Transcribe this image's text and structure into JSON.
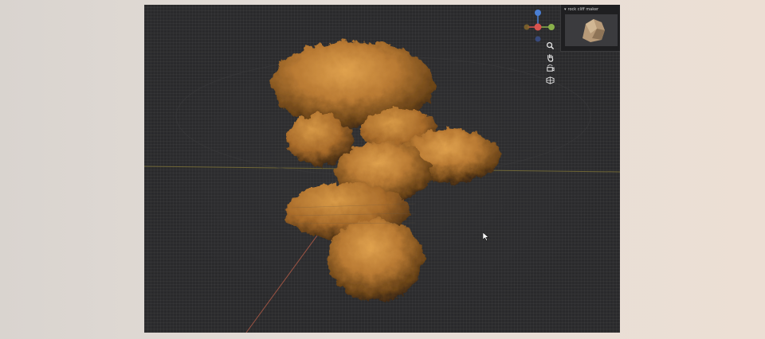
{
  "viewport": {
    "background": "#2a2a2c",
    "object_color": "#c98a3c",
    "x_axis_color": "#8a7a3a",
    "y_axis_color": "#c0604a"
  },
  "gizmo": {
    "x_axis_color": "#d9534f",
    "y_axis_color": "#8ab04a",
    "z_axis_color": "#4a7fd4"
  },
  "nav_icons": [
    "zoom-icon",
    "hand-pan-icon",
    "camera-orbit-icon",
    "grid-view-icon"
  ],
  "preview": {
    "title": "rock cliff maker",
    "thumb_color": "#b79a78"
  }
}
